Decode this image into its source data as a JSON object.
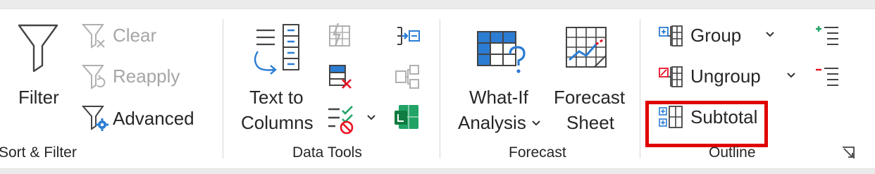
{
  "sort_filter": {
    "filter_label": "Filter",
    "clear_label": "Clear",
    "reapply_label": "Reapply",
    "advanced_label": "Advanced",
    "group_label": "Sort & Filter"
  },
  "data_tools": {
    "text_to_columns_line1": "Text to",
    "text_to_columns_line2": "Columns",
    "group_label": "Data Tools"
  },
  "forecast": {
    "whatif_line1": "What-If",
    "whatif_line2": "Analysis",
    "forecast_sheet_line1": "Forecast",
    "forecast_sheet_line2": "Sheet",
    "group_label": "Forecast"
  },
  "outline": {
    "group_label_btn": "Group",
    "ungroup_label": "Ungroup",
    "subtotal_label": "Subtotal",
    "group_label": "Outline"
  },
  "colors": {
    "accent_blue": "#2b7cd3",
    "delete_red": "#e81123",
    "highlight_red": "#e00000",
    "excel_green": "#21a366"
  }
}
